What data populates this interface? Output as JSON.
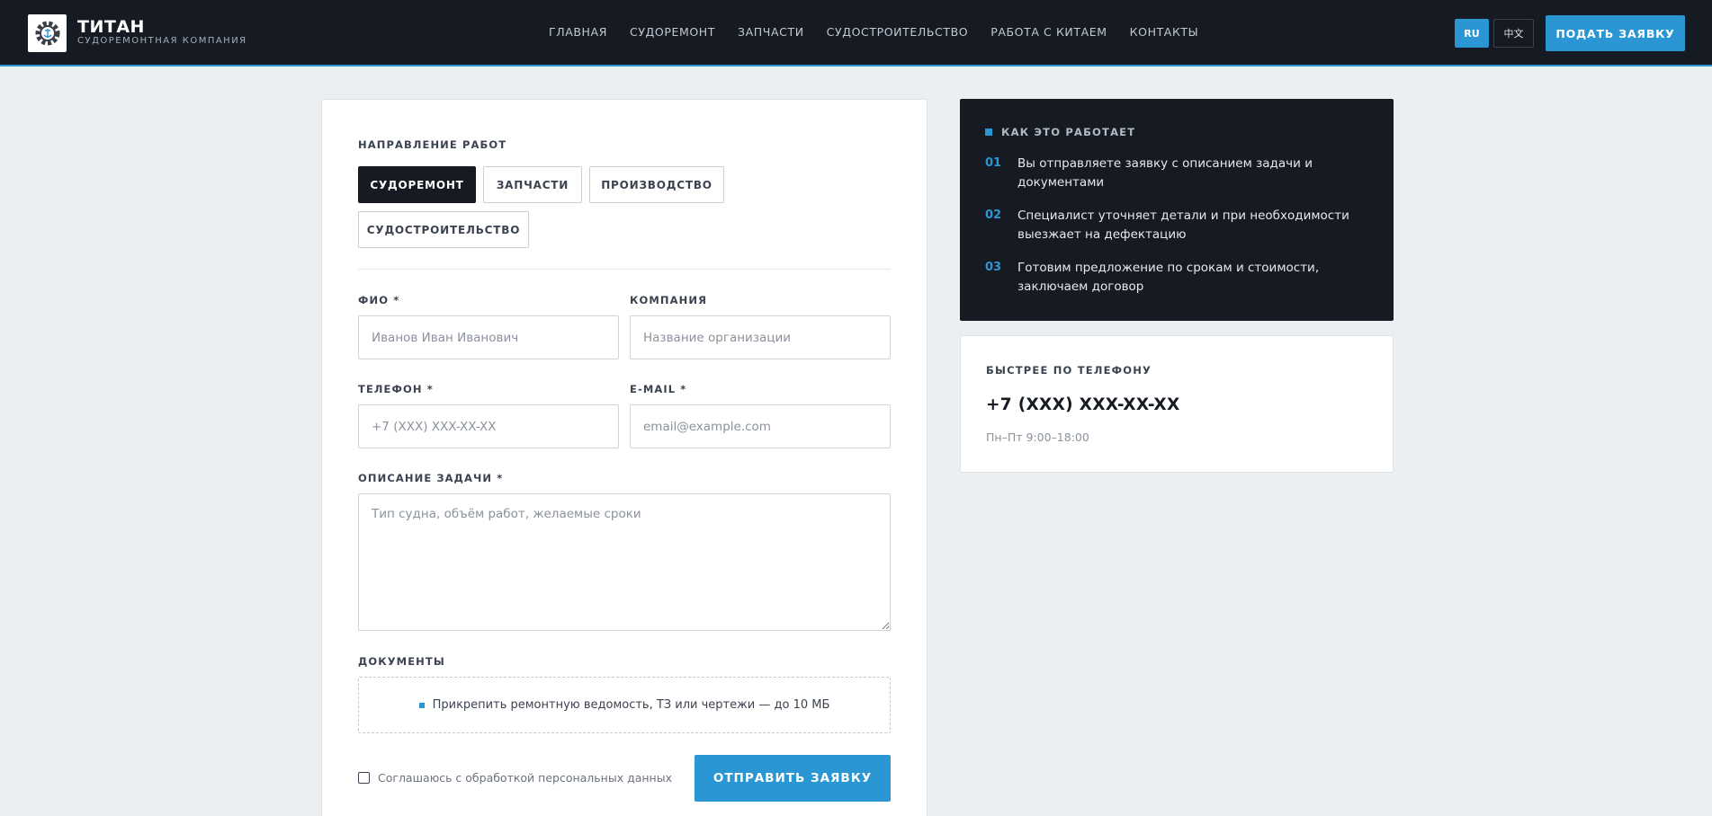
{
  "header": {
    "brand_name": "ТИТАН",
    "brand_sub": "СУДОРЕМОНТНАЯ КОМПАНИЯ",
    "logo_icon": "gear-anchor-icon",
    "nav": [
      "ГЛАВНАЯ",
      "СУДОРЕМОНТ",
      "ЗАПЧАСТИ",
      "СУДОСТРОИТЕЛЬСТВО",
      "РАБОТА С КИТАЕМ",
      "КОНТАКТЫ"
    ],
    "lang_ru": "RU",
    "lang_zh": "中文",
    "cta": "ПОДАТЬ ЗАЯВКУ"
  },
  "form": {
    "direction_label": "НАПРАВЛЕНИЕ РАБОТ",
    "chips": [
      "СУДОРЕМОНТ",
      "ЗАПЧАСТИ",
      "ПРОИЗВОДСТВО",
      "СУДОСТРОИТЕЛЬСТВО"
    ],
    "active_chip": "СУДОРЕМОНТ",
    "name_label": "ФИО *",
    "name_placeholder": "Иванов Иван Иванович",
    "company_label": "КОМПАНИЯ",
    "company_placeholder": "Название организации",
    "phone_label": "ТЕЛЕФОН *",
    "phone_placeholder": "+7 (XXX) XXX-XX-XX",
    "email_label": "E-MAIL *",
    "email_placeholder": "email@example.com",
    "task_label": "ОПИСАНИЕ ЗАДАЧИ *",
    "task_placeholder": "Тип судна, объём работ, желаемые сроки",
    "docs_label": "ДОКУМЕНТЫ",
    "docs_text": "Прикрепить ремонтную ведомость, ТЗ или чертежи — до 10 МБ",
    "consent": "Соглашаюсь с обработкой персональных данных",
    "submit": "ОТПРАВИТЬ ЗАЯВКУ"
  },
  "how": {
    "title": "КАК ЭТО РАБОТАЕТ",
    "steps": [
      {
        "num": "01",
        "text": "Вы отправляете заявку с описанием задачи и документами"
      },
      {
        "num": "02",
        "text": "Специалист уточняет детали и при необходимости выезжает на дефектацию"
      },
      {
        "num": "03",
        "text": "Готовим предложение по срокам и стоимости, заключаем договор"
      }
    ]
  },
  "phone": {
    "label": "БЫСТРЕЕ ПО ТЕЛЕФОНУ",
    "number": "+7 (XXX) XXX-XX-XX",
    "hours": "Пн–Пт 9:00–18:00"
  },
  "colors": {
    "accent": "#2a97d4",
    "dark": "#161b23",
    "background": "#eceff2"
  }
}
